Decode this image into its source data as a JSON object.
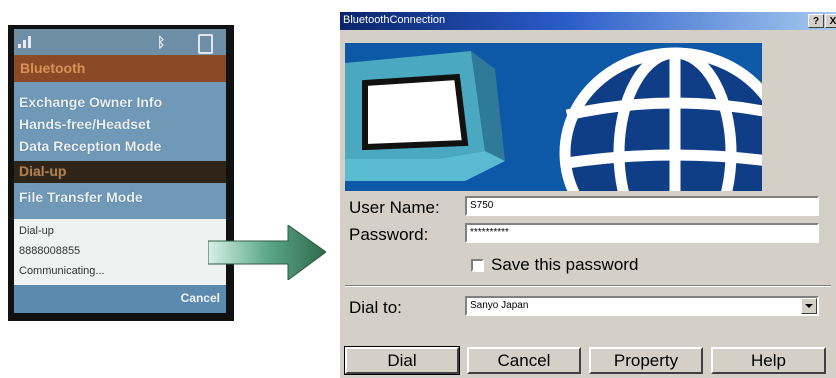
{
  "phone": {
    "header": "Bluetooth",
    "menu_items": [
      {
        "label": "Exchange Owner Info",
        "selected": false
      },
      {
        "label": "Hands-free/Headset",
        "selected": false
      },
      {
        "label": "Data Reception Mode",
        "selected": false
      },
      {
        "label": "Dial-up",
        "selected": true
      },
      {
        "label": "File Transfer Mode",
        "selected": false
      }
    ],
    "popup": {
      "line1": "Dial-up",
      "line2": "8888008855",
      "line3": "Communicating..."
    },
    "softkey": "Cancel"
  },
  "dialog": {
    "title": "BluetoothConnection",
    "help_btn": "?",
    "close_btn": "X",
    "user_name_label": "User Name:",
    "user_name_value": "S750",
    "password_label": "Password:",
    "password_value": "**********",
    "save_password_label": "Save this password",
    "save_password_checked": false,
    "dial_to_label": "Dial to:",
    "dial_to_value": "Sanyo Japan",
    "buttons": {
      "dial": "Dial",
      "cancel": "Cancel",
      "property": "Property",
      "help": "Help"
    }
  },
  "colors": {
    "titlebar": "#0a246a",
    "dialog_face": "#d4d0c8",
    "phone_bg": "#6f99b7",
    "phone_header": "#8a4a26",
    "banner_blue": "#0e58a8"
  },
  "icons": [
    "signal-icon",
    "bluetooth-icon",
    "battery-icon",
    "arrow-right-icon",
    "monitor-icon",
    "globe-icon",
    "dropdown-arrow-icon"
  ]
}
